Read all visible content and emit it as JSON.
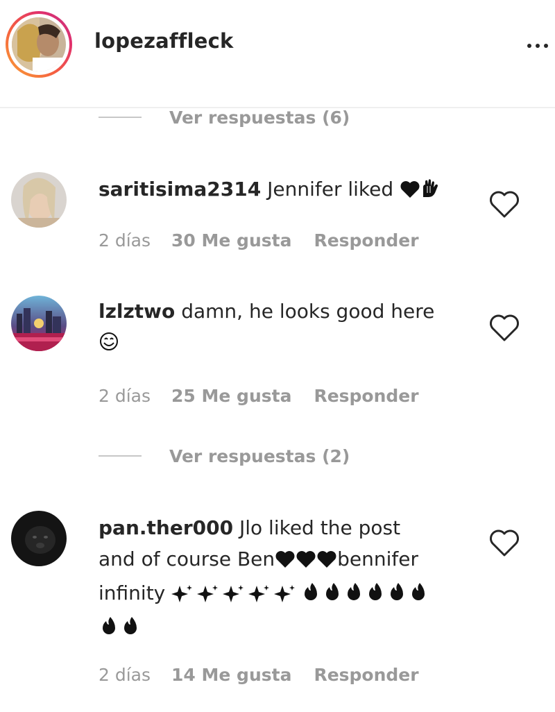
{
  "header": {
    "username": "lopezaffleck",
    "more_icon": "more-horizontal-icon"
  },
  "replies_top": {
    "label": "Ver respuestas (6)"
  },
  "comments": [
    {
      "username": "saritisima2314",
      "text": "Jennifer liked",
      "emoji": "❤️🙌",
      "time": "2 días",
      "likes": "30 Me gusta",
      "reply": "Responder"
    },
    {
      "username": "lzlztwo",
      "text": "damn, he looks good here",
      "emoji": "😊",
      "time": "2 días",
      "likes": "25 Me gusta",
      "reply": "Responder",
      "replies_label": "Ver respuestas (2)"
    },
    {
      "username": "pan.ther000",
      "text_line1": "Jlo liked the post",
      "text_line2a": "and of course Ben",
      "text_line2b": "bennifer",
      "text_line3": "infinity",
      "emoji_hearts": "❤️❤️❤️",
      "emoji_sparkles": "✨✨✨✨✨",
      "emoji_fire": "🔥🔥🔥🔥🔥🔥🔥🔥",
      "time": "2 días",
      "likes": "14 Me gusta",
      "reply": "Responder"
    }
  ]
}
